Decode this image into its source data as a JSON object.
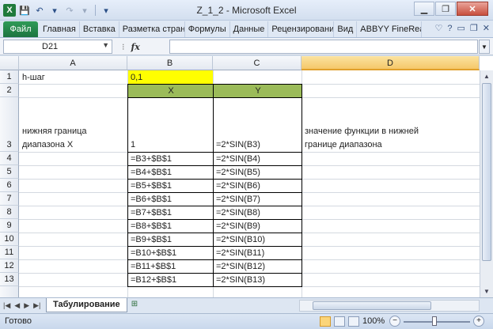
{
  "window": {
    "title": "Z_1_2  -  Microsoft Excel",
    "minimize": "▁",
    "maximize": "❐",
    "close": "✕"
  },
  "ribbon": {
    "file": "Файл",
    "tabs": [
      "Главная",
      "Вставка",
      "Разметка страни",
      "Формулы",
      "Данные",
      "Рецензировани",
      "Вид",
      "ABBYY FineReade"
    ]
  },
  "formula_bar": {
    "name_box": "D21",
    "fx": "fx",
    "content": ""
  },
  "columns": [
    "A",
    "B",
    "C",
    "D"
  ],
  "rows": [
    "1",
    "2",
    "3",
    "4",
    "5",
    "6",
    "7",
    "8",
    "9",
    "10",
    "11",
    "12",
    "13"
  ],
  "cells": {
    "A1": "h-шаг",
    "B1": "0,1",
    "B2": "X",
    "C2": "Y",
    "A3_line1": "нижняя граница",
    "A3_line2": "диапазона X",
    "B3": "1",
    "C3": "=2*SIN(B3)",
    "D3_line1": "значение функции в нижней",
    "D3_line2": "границе диапазона",
    "B_formulas": [
      "=B3+$B$1",
      "=B4+$B$1",
      "=B5+$B$1",
      "=B6+$B$1",
      "=B7+$B$1",
      "=B8+$B$1",
      "=B9+$B$1",
      "=B10+$B$1",
      "=B11+$B$1",
      "=B12+$B$1"
    ],
    "C_formulas": [
      "=2*SIN(B4)",
      "=2*SIN(B5)",
      "=2*SIN(B6)",
      "=2*SIN(B7)",
      "=2*SIN(B8)",
      "=2*SIN(B9)",
      "=2*SIN(B10)",
      "=2*SIN(B11)",
      "=2*SIN(B12)",
      "=2*SIN(B13)"
    ]
  },
  "sheet_tabs": {
    "active": "Табулирование"
  },
  "status": {
    "ready": "Готово",
    "zoom": "100%"
  },
  "colors": {
    "yellow_fill": "#ffff00",
    "green_fill": "#9bbb59",
    "file_tab": "#1d7440"
  }
}
